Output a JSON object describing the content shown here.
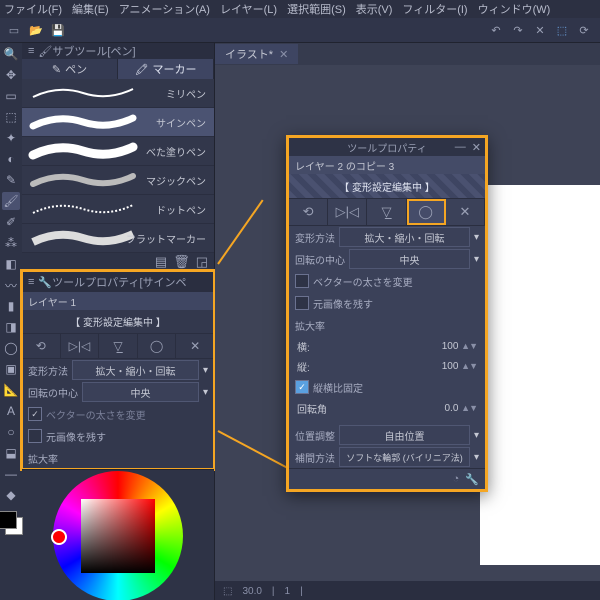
{
  "menu": {
    "file": "ファイル(F)",
    "edit": "編集(E)",
    "anim": "アニメーション(A)",
    "layer": "レイヤー(L)",
    "select": "選択範囲(S)",
    "view": "表示(V)",
    "filter": "フィルター(I)",
    "window": "ウィンドウ(W)"
  },
  "doc_tab": "イラスト*",
  "subtool": {
    "header": "サブツール[ペン]",
    "tab_pen": "ペン",
    "tab_marker": "マーカー",
    "items": [
      "ミリペン",
      "サインペン",
      "べた塗りペン",
      "マジックペン",
      "ドットペン",
      "フラットマーカー"
    ]
  },
  "prop_small": {
    "header": "ツールプロパティ[サインペ",
    "tab": "レイヤー 1",
    "title": "【 変形設定編集中 】",
    "method_lbl": "変形方法",
    "method_val": "拡大・縮小・回転",
    "center_lbl": "回転の中心",
    "center_val": "中央",
    "vec": "ベクターの太さを変更",
    "keep": "元画像を残す",
    "scale": "拡大率"
  },
  "dialog": {
    "title": "ツールプロパティ",
    "tab": "レイヤー 2 のコピー 3",
    "subtitle": "【 変形設定編集中 】",
    "method_lbl": "変形方法",
    "method_val": "拡大・縮小・回転",
    "center_lbl": "回転の中心",
    "center_val": "中央",
    "vec": "ベクターの太さを変更",
    "keep": "元画像を残す",
    "scale_lbl": "拡大率",
    "h": "横:",
    "w": "縦:",
    "hv": "100",
    "wv": "100",
    "lock": "縦横比固定",
    "rot_lbl": "回転角",
    "rot_val": "0.0",
    "pos_lbl": "位置調整",
    "pos_val": "自由位置",
    "interp_lbl": "補間方法",
    "interp_val": "ソフトな輪郭 (バイリニア法)"
  },
  "timeline": {
    "a": "30.0",
    "b": "1"
  }
}
